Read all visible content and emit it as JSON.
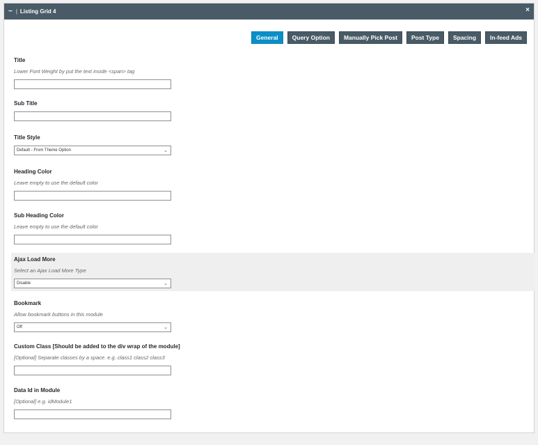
{
  "window": {
    "title": "Listing Grid 4",
    "sep": "|"
  },
  "icons": {
    "collapse": "−",
    "close": "×",
    "chevron": "⌄"
  },
  "tabs": [
    {
      "label": "General",
      "active": true
    },
    {
      "label": "Query Option"
    },
    {
      "label": "Manually Pick Post"
    },
    {
      "label": "Post Type"
    },
    {
      "label": "Spacing"
    },
    {
      "label": "In-feed Ads"
    }
  ],
  "fields": {
    "title": {
      "label": "Title",
      "desc": "Lower Font Weight by put the text inside <span> tag",
      "value": ""
    },
    "sub_title": {
      "label": "Sub Title",
      "value": ""
    },
    "title_style": {
      "label": "Title Style",
      "selected": "Default - From Theme Option"
    },
    "heading_color": {
      "label": "Heading Color",
      "desc": "Leave empty to use the default color",
      "value": ""
    },
    "sub_heading_color": {
      "label": "Sub Heading Color",
      "desc": "Leave empty to use the default color",
      "value": ""
    },
    "ajax_load_more": {
      "label": "Ajax Load More",
      "desc": "Select an Ajax Load More Type",
      "selected": "Disable"
    },
    "bookmark": {
      "label": "Bookmark",
      "desc": "Allow bookmark buttons in this module",
      "selected": "Off"
    },
    "custom_class": {
      "label": "Custom Class [Should be added to the div wrap of the module]",
      "desc": "[Optional] Separate classes by a space. e.g. class1 class2 class3",
      "value": ""
    },
    "data_id": {
      "label": "Data Id in Module",
      "desc": "[Optional] e.g. idModule1",
      "value": ""
    }
  },
  "colors": {
    "header": "#485b66",
    "active_tab": "#0a8fc7",
    "highlight_row": "#efefef"
  }
}
